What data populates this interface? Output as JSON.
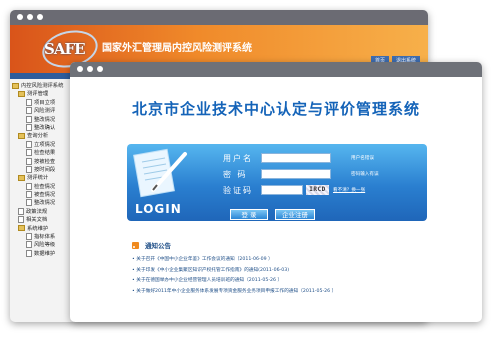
{
  "back_window": {
    "logo_text": "SAFE",
    "title": "国家外汇管理局内控风险测评系统",
    "header_links": [
      "首页",
      "退出系统"
    ],
    "tree": [
      {
        "level": 0,
        "type": "folder",
        "label": "内控风险测评系统"
      },
      {
        "level": 1,
        "type": "folder",
        "label": "测评管理"
      },
      {
        "level": 2,
        "type": "doc",
        "label": "项目立项"
      },
      {
        "level": 2,
        "type": "doc",
        "label": "风险测评"
      },
      {
        "level": 2,
        "type": "doc",
        "label": "整改情况"
      },
      {
        "level": 2,
        "type": "doc",
        "label": "整改确认"
      },
      {
        "level": 1,
        "type": "folder",
        "label": "查询分析"
      },
      {
        "level": 2,
        "type": "doc",
        "label": "立项情况"
      },
      {
        "level": 2,
        "type": "doc",
        "label": "检查结果"
      },
      {
        "level": 2,
        "type": "doc",
        "label": "按被检查"
      },
      {
        "level": 2,
        "type": "doc",
        "label": "按时间段"
      },
      {
        "level": 1,
        "type": "folder",
        "label": "测评统计"
      },
      {
        "level": 2,
        "type": "doc",
        "label": "检查情况"
      },
      {
        "level": 2,
        "type": "doc",
        "label": "被查情况"
      },
      {
        "level": 2,
        "type": "doc",
        "label": "整改情况"
      },
      {
        "level": 1,
        "type": "doc",
        "label": "政策法规"
      },
      {
        "level": 1,
        "type": "doc",
        "label": "相关文档"
      },
      {
        "level": 1,
        "type": "folder",
        "label": "系统维护"
      },
      {
        "level": 2,
        "type": "doc",
        "label": "指标体系"
      },
      {
        "level": 2,
        "type": "doc",
        "label": "风险等级"
      },
      {
        "level": 2,
        "type": "doc",
        "label": "数据维护"
      }
    ]
  },
  "front_window": {
    "title": "北京市企业技术中心认定与评价管理系统",
    "login": {
      "login_label": "LOGIN",
      "username_label": "用户名",
      "username_hint": "用户名错误",
      "password_label": "密 码",
      "password_hint": "密码输入有误",
      "captcha_label": "验证码",
      "captcha_code": "IRCD",
      "captcha_refresh": "看不清？换一张",
      "login_button": "登 录",
      "register_button": "企业注册"
    },
    "notices": {
      "title": "通知公告",
      "items": [
        "• 关于召开《中国中小企业年鉴》工作会议的通知（2011-06-09 ）",
        "• 关于印发《中小企业集聚区知识产权托管工作指南》的通知(2011-06-03)",
        "• 关于在德国举办中小企业经营管理人员培训班的通知（2011-05-26 ）",
        "• 关于做好2011年中小企业服务体系发展专项资金服务业务项目申报工作的通知（2011-05-26 ）"
      ]
    }
  },
  "colors": {
    "banner_orange": "#f08a2a",
    "title_blue": "#1463b8",
    "panel_blue": "#2a7fd0"
  }
}
